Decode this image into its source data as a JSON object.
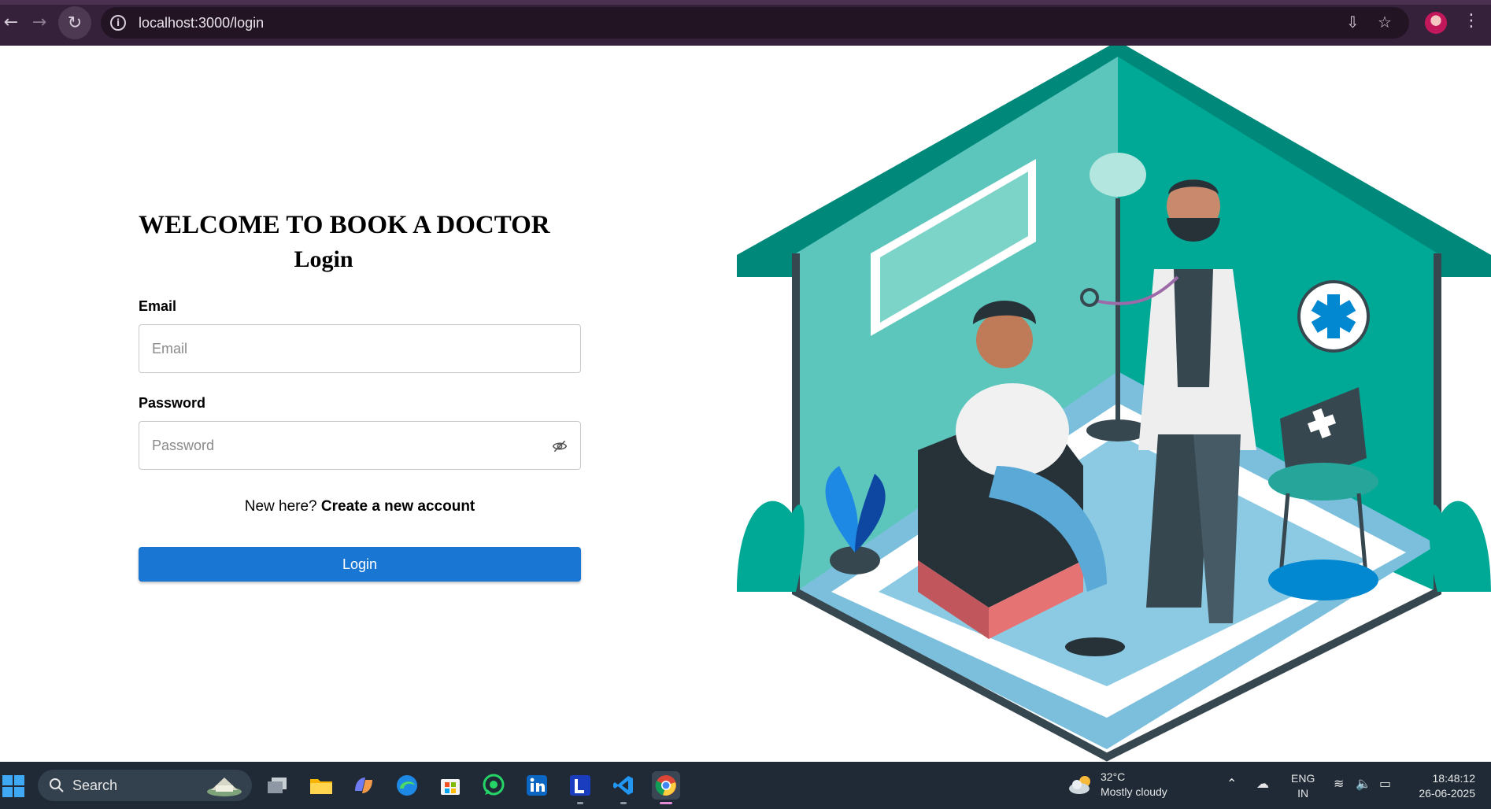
{
  "browser": {
    "url": "localhost:3000/login",
    "back_icon": "arrow-left",
    "forward_icon": "arrow-right",
    "reload_icon": "reload",
    "info_icon": "info",
    "install_icon": "install-app",
    "bookmark_icon": "star",
    "menu_icon": "vertical-dots"
  },
  "page": {
    "welcome": "WELCOME TO BOOK A DOCTOR",
    "title": "Login",
    "email_label": "Email",
    "email_placeholder": "Email",
    "password_label": "Password",
    "password_placeholder": "Password",
    "signup_prefix": "New here?",
    "signup_link": "Create a new account",
    "login_button": "Login",
    "accent": "#1976d2"
  },
  "taskbar": {
    "search_placeholder": "Search",
    "weather_temp": "32°C",
    "weather_desc": "Mostly cloudy",
    "lang_1": "ENG",
    "lang_2": "IN",
    "time": "18:48:12",
    "date": "26-06-2025",
    "apps": [
      "task-view",
      "file-explorer",
      "copilot",
      "edge",
      "microsoft-store",
      "whatsapp",
      "linkedin",
      "l-app",
      "vscode",
      "chrome"
    ]
  }
}
